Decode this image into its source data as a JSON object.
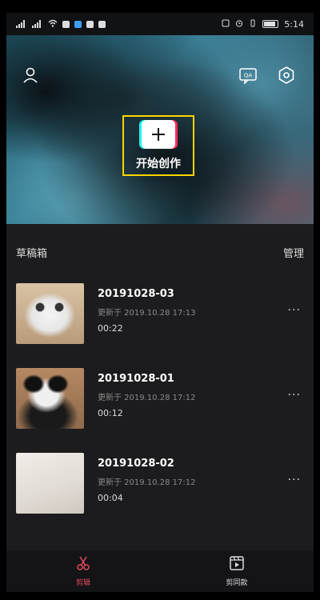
{
  "status_bar": {
    "time": "5:14",
    "battery_label": ""
  },
  "header": {
    "profile_icon": "user-icon",
    "tutorial_icon": "qa-icon",
    "settings_icon": "gear-icon",
    "create_label": "开始创作"
  },
  "drafts": {
    "title": "草稿箱",
    "manage_label": "管理",
    "items": [
      {
        "name": "20191028-03",
        "updated": "更新于 2019.10.28 17:13",
        "duration": "00:22",
        "thumb": "cat"
      },
      {
        "name": "20191028-01",
        "updated": "更新于 2019.10.28 17:12",
        "duration": "00:12",
        "thumb": "panda"
      },
      {
        "name": "20191028-02",
        "updated": "更新于 2019.10.28 17:12",
        "duration": "00:04",
        "thumb": "paper"
      }
    ],
    "more_label": "···"
  },
  "tabbar": {
    "tabs": [
      {
        "label": "剪辑",
        "icon": "scissors-icon",
        "active": true
      },
      {
        "label": "剪同款",
        "icon": "template-clip-icon",
        "active": false
      }
    ]
  },
  "colors": {
    "accent": "#e44a5d",
    "highlight": "#ffd400",
    "background": "#1c1c1e"
  }
}
